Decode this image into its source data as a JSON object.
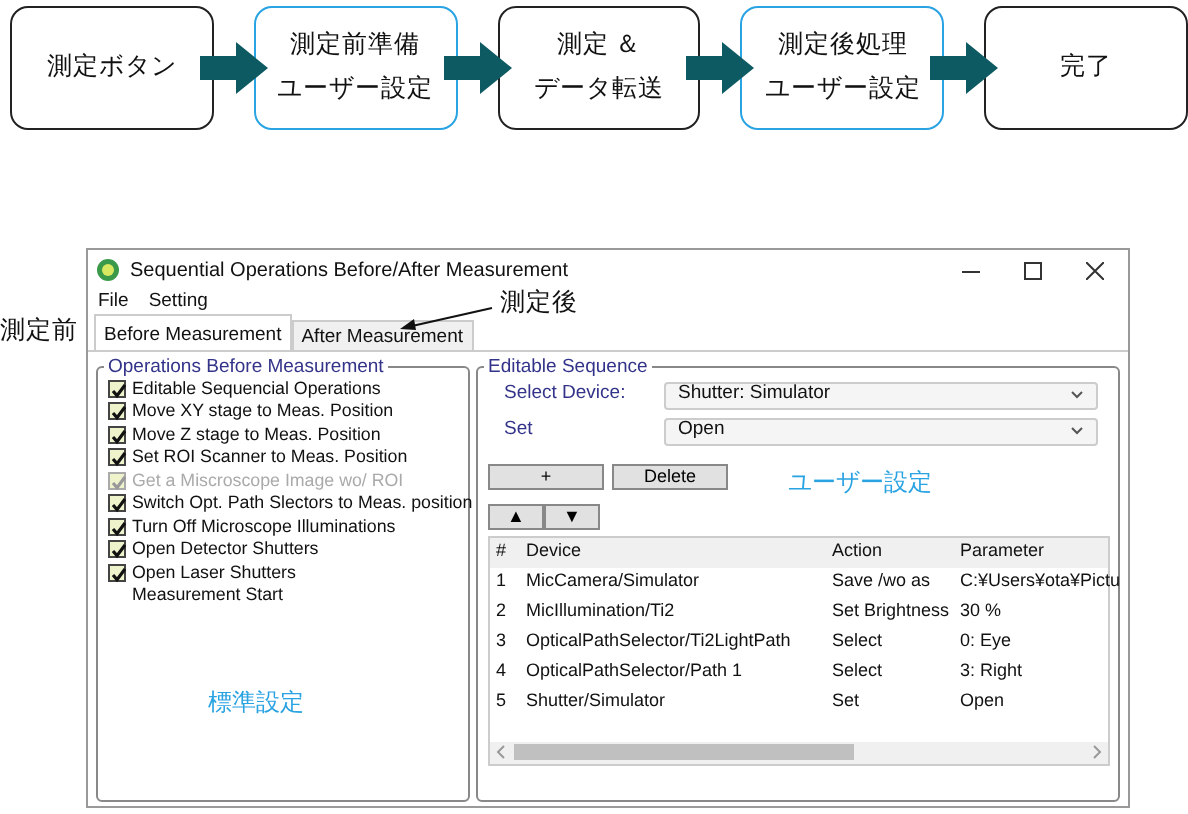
{
  "flow": [
    {
      "lines": [
        "測定ボタン"
      ],
      "highlighted": false
    },
    {
      "lines": [
        "測定前準備",
        "ユーザー設定"
      ],
      "highlighted": true
    },
    {
      "lines": [
        "測定 ＆",
        "データ転送"
      ],
      "highlighted": false
    },
    {
      "lines": [
        "測定後処理",
        "ユーザー設定"
      ],
      "highlighted": true
    },
    {
      "lines": [
        "完了"
      ],
      "highlighted": false
    }
  ],
  "annotations": {
    "before_tab": "測定前",
    "after_tab": "測定後",
    "standard": "標準設定",
    "user": "ユーザー設定"
  },
  "window": {
    "title": "Sequential Operations Before/After Measurement",
    "menu": [
      "File",
      "Setting"
    ],
    "tabs": [
      {
        "label": "Before Measurement",
        "selected": true
      },
      {
        "label": "After Measurement",
        "selected": false
      }
    ],
    "left_group": {
      "title": "Operations Before Measurement",
      "items": [
        {
          "kind": "checkbox",
          "label": "Editable Sequencial Operations",
          "checked": true,
          "disabled": false
        },
        {
          "kind": "checkbox",
          "label": "Move XY stage to Meas. Position",
          "checked": true,
          "disabled": false
        },
        {
          "kind": "checkbox",
          "label": "Move Z stage to Meas. Position",
          "checked": true,
          "disabled": false
        },
        {
          "kind": "checkbox",
          "label": "Set ROI Scanner to Meas. Position",
          "checked": true,
          "disabled": false
        },
        {
          "kind": "checkbox",
          "label": "Get a Miscroscope Image wo/ ROI",
          "checked": true,
          "disabled": true
        },
        {
          "kind": "checkbox",
          "label": "Switch Opt. Path Slectors to Meas. position",
          "checked": true,
          "disabled": false
        },
        {
          "kind": "checkbox",
          "label": "Turn  Off Microscope Illuminations",
          "checked": true,
          "disabled": false
        },
        {
          "kind": "checkbox",
          "label": "Open Detector Shutters",
          "checked": true,
          "disabled": false
        },
        {
          "kind": "checkbox",
          "label": "Open Laser Shutters",
          "checked": true,
          "disabled": false
        },
        {
          "kind": "label",
          "label": "Measurement Start"
        }
      ]
    },
    "right_group": {
      "title": "Editable Sequence",
      "fields": [
        {
          "label": "Select Device:",
          "value": "Shutter: Simulator"
        },
        {
          "label": "Set",
          "value": "Open"
        }
      ],
      "buttons": [
        "+",
        "Delete"
      ],
      "move_buttons": [
        "▲",
        "▼"
      ],
      "table": {
        "columns": [
          "#",
          "Device",
          "Action",
          "Parameter"
        ],
        "rows": [
          [
            "1",
            "MicCamera/Simulator",
            "Save  /wo as",
            "C:¥Users¥ota¥Pictu"
          ],
          [
            "2",
            "MicIllumination/Ti2",
            "Set Brightness",
            "30 %"
          ],
          [
            "3",
            "OpticalPathSelector/Ti2LightPath",
            "Select",
            "0: Eye"
          ],
          [
            "4",
            "OpticalPathSelector/Path 1",
            "Select",
            "3: Right"
          ],
          [
            "5",
            "Shutter/Simulator",
            "Set",
            "Open"
          ]
        ]
      }
    }
  }
}
